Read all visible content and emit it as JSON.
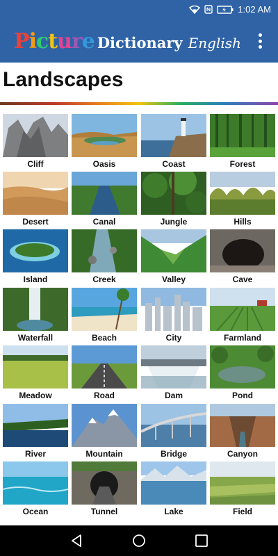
{
  "status": {
    "time": "1:02 AM",
    "icons": [
      "wifi-icon",
      "nfc-icon",
      "battery-icon"
    ]
  },
  "app": {
    "logo_picture": "Picture",
    "logo_dictionary": "Dictionary",
    "logo_english": "English",
    "logo_colors": [
      "#e8423a",
      "#f39c12",
      "#2ecc71",
      "#f1c40f",
      "#e84393",
      "#9b59b6",
      "#3498db"
    ]
  },
  "page": {
    "title": "Landscapes"
  },
  "items": [
    {
      "label": "Cliff",
      "icon": "cliff-image"
    },
    {
      "label": "Oasis",
      "icon": "oasis-image"
    },
    {
      "label": "Coast",
      "icon": "coast-image"
    },
    {
      "label": "Forest",
      "icon": "forest-image"
    },
    {
      "label": "Desert",
      "icon": "desert-image"
    },
    {
      "label": "Canal",
      "icon": "canal-image"
    },
    {
      "label": "Jungle",
      "icon": "jungle-image"
    },
    {
      "label": "Hills",
      "icon": "hills-image"
    },
    {
      "label": "Island",
      "icon": "island-image"
    },
    {
      "label": "Creek",
      "icon": "creek-image"
    },
    {
      "label": "Valley",
      "icon": "valley-image"
    },
    {
      "label": "Cave",
      "icon": "cave-image"
    },
    {
      "label": "Waterfall",
      "icon": "waterfall-image"
    },
    {
      "label": "Beach",
      "icon": "beach-image"
    },
    {
      "label": "City",
      "icon": "city-image"
    },
    {
      "label": "Farmland",
      "icon": "farmland-image"
    },
    {
      "label": "Meadow",
      "icon": "meadow-image"
    },
    {
      "label": "Road",
      "icon": "road-image"
    },
    {
      "label": "Dam",
      "icon": "dam-image"
    },
    {
      "label": "Pond",
      "icon": "pond-image"
    },
    {
      "label": "River",
      "icon": "river-image"
    },
    {
      "label": "Mountain",
      "icon": "mountain-image"
    },
    {
      "label": "Bridge",
      "icon": "bridge-image"
    },
    {
      "label": "Canyon",
      "icon": "canyon-image"
    },
    {
      "label": "Ocean",
      "icon": "ocean-image"
    },
    {
      "label": "Tunnel",
      "icon": "tunnel-image"
    },
    {
      "label": "Lake",
      "icon": "lake-image"
    },
    {
      "label": "Field",
      "icon": "field-image"
    }
  ],
  "nav": {
    "back": "back-icon",
    "home": "home-icon",
    "recents": "recents-icon"
  },
  "colors": {
    "app_bar": "#2f63a6",
    "nav_bar": "#000000"
  }
}
